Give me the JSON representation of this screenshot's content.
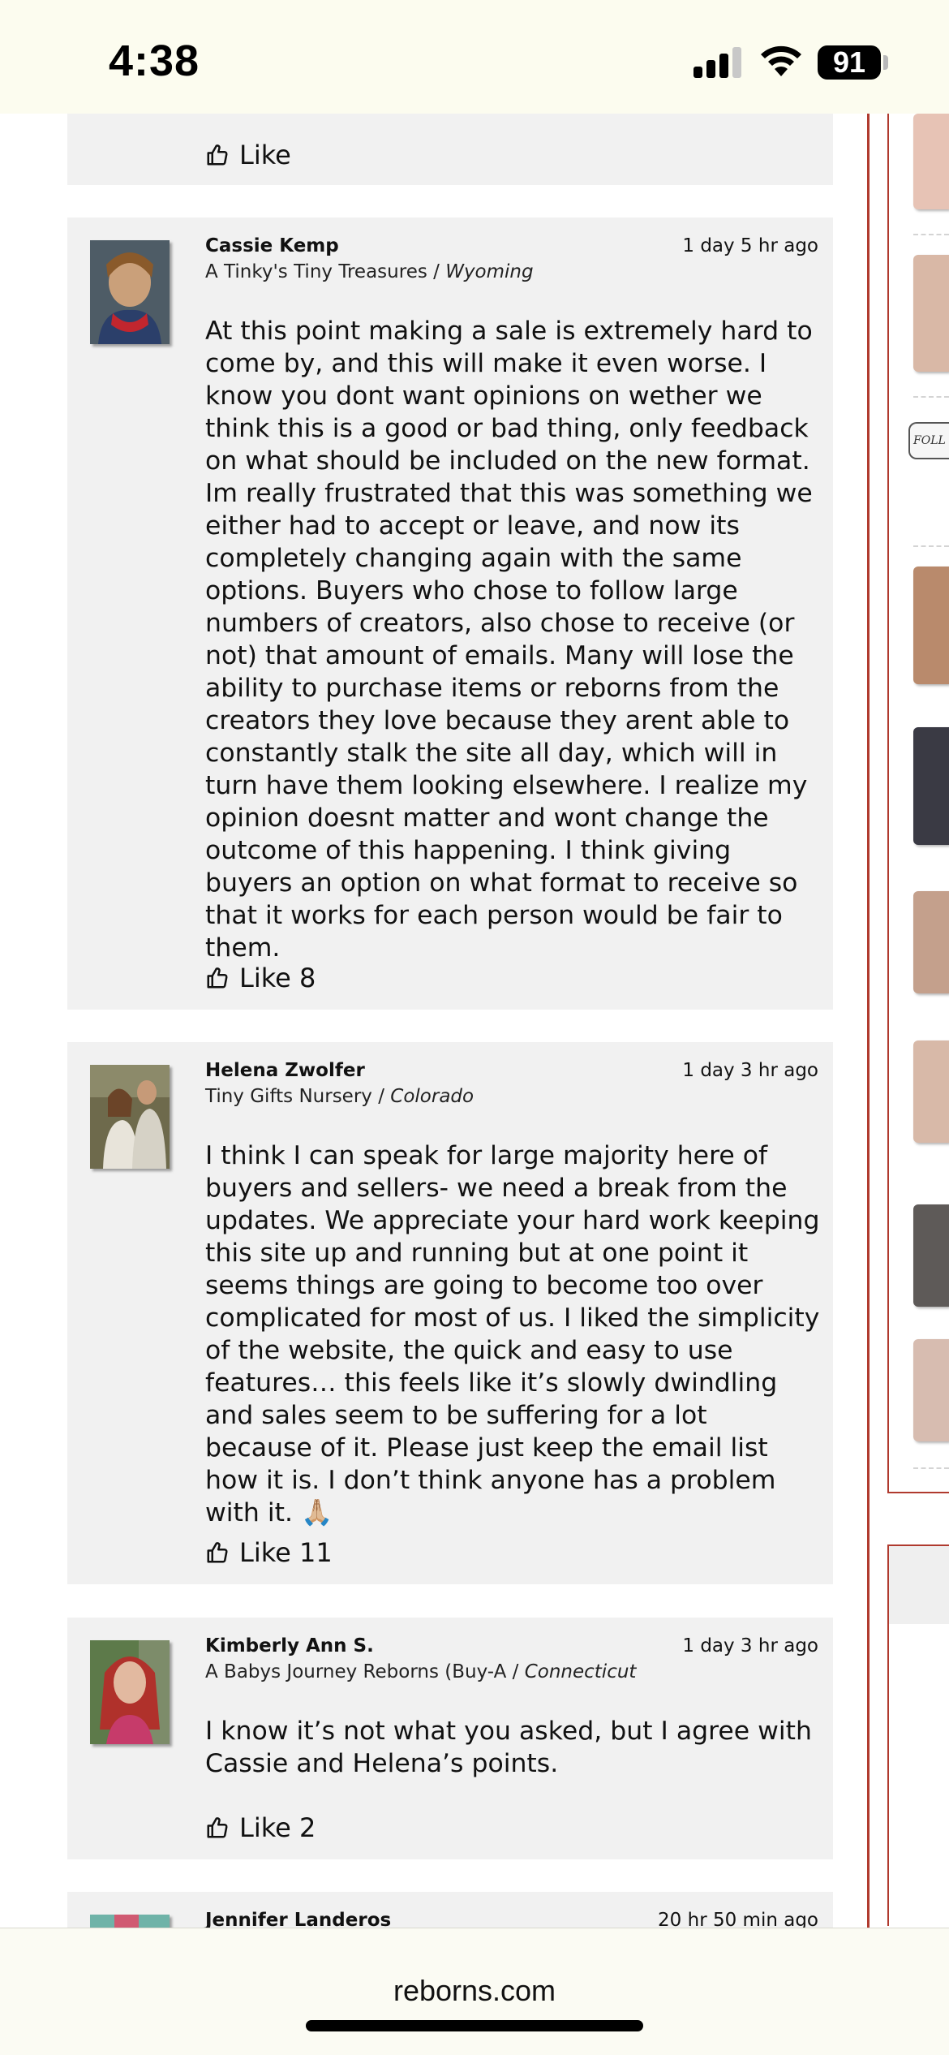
{
  "status_bar": {
    "time": "4:38",
    "battery": "91"
  },
  "comments": [
    {
      "like_label": "Like",
      "like_count": ""
    },
    {
      "author": "Cassie Kemp",
      "time": "1 day 5 hr ago",
      "shop": "A Tinky's Tiny Treasures",
      "location": "Wyoming",
      "text": "At this point making a sale is extremely hard to come by, and this will make it even worse. I know you dont want opinions on wether we think this is a good or bad thing, only feedback on what should be included on the new format. Im really frustrated that this was something we either had to accept or leave, and now its completely changing again with the same options. Buyers who chose to follow large numbers of creators, also chose to receive (or not) that amount of emails. Many will lose the ability to purchase items or reborns from the creators they love because they arent able to constantly stalk the site all day, which will in turn have them looking elsewhere. I realize my opinion doesnt matter and wont change the outcome of this happening. I think giving buyers an option on what format to receive so that it works for each person would be fair to them.",
      "like_label": "Like",
      "like_count": "8"
    },
    {
      "author": "Helena Zwolfer",
      "time": "1 day 3 hr ago",
      "shop": "Tiny Gifts Nursery",
      "location": "Colorado",
      "text": "I think I can speak for large majority here of buyers and sellers- we need a break from the updates. We appreciate your hard work keeping this site up and running but at one point it seems things are going to become too over complicated for most of us. I liked the simplicity of the website, the quick and easy to use features… this feels like it’s slowly dwindling and sales seem to be suffering for a lot because of it. Please just keep the email list how it is. I don’t think anyone has a problem with it. 🙏🏼",
      "like_label": "Like",
      "like_count": "11"
    },
    {
      "author": "Kimberly Ann S.",
      "time": "1 day 3 hr ago",
      "shop": "A Babys Journey Reborns (Buy-A",
      "location": "Connecticut",
      "text": "I know it’s not what you asked, but I agree with Cassie and Helena’s points.",
      "like_label": "Like",
      "like_count": "2"
    },
    {
      "author": "Jennifer Landeros",
      "time": "20 hr 50 min ago"
    }
  ],
  "sidebar": {
    "follow_badge": "FOLL"
  },
  "url_bar": {
    "domain": "reborns.com"
  }
}
